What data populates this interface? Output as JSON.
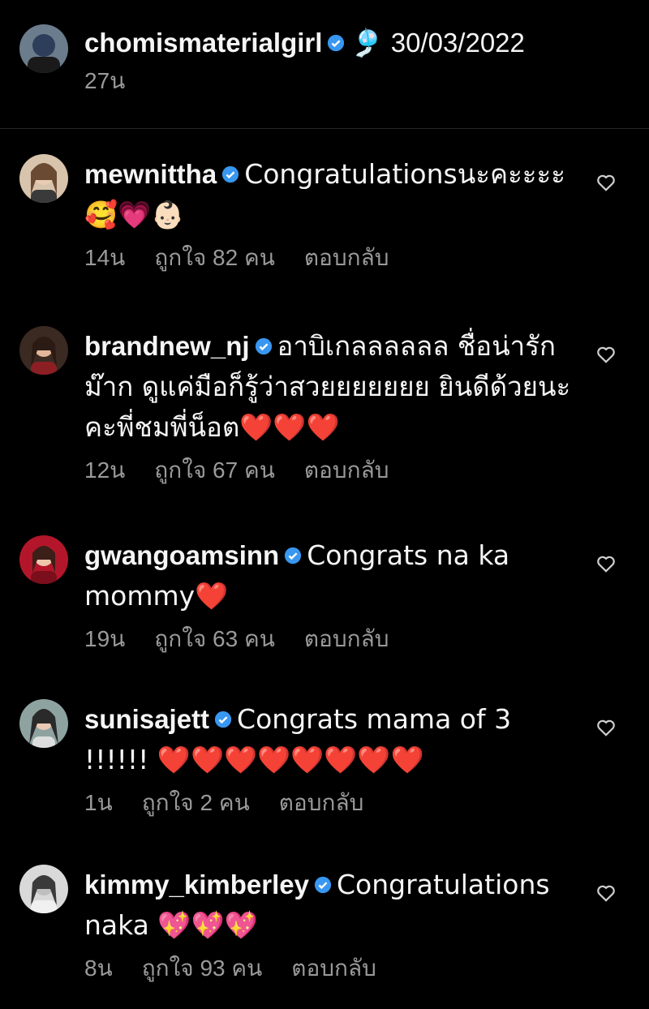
{
  "post": {
    "username": "chomismaterialgirl",
    "caption": "🎐 30/03/2022",
    "time": "27น"
  },
  "comments": [
    {
      "username": "mewnittha",
      "text": "Congratulationsนะคะะะะ🥰💗👶🏻",
      "time": "14น",
      "likes": "ถูกใจ 82 คน",
      "reply": "ตอบกลับ"
    },
    {
      "username": "brandnew_nj",
      "text": "อาบิเกลลลลลล ชื่อน่ารักม๊าก ดูแค่มือก็รู้ว่าสวยยยยยยย ยินดีด้วยนะคะพี่ชมพี่น็อต❤️❤️❤️",
      "time": "12น",
      "likes": "ถูกใจ 67 คน",
      "reply": "ตอบกลับ"
    },
    {
      "username": "gwangoamsinn",
      "text": "Congrats na ka mommy❤️",
      "time": "19น",
      "likes": "ถูกใจ 63 คน",
      "reply": "ตอบกลับ"
    },
    {
      "username": "sunisajett",
      "text": "Congrats mama of 3 !!!!!! ❤️❤️❤️❤️❤️❤️❤️❤️",
      "time": "1น",
      "likes": "ถูกใจ 2 คน",
      "reply": "ตอบกลับ"
    },
    {
      "username": "kimmy_kimberley",
      "text": "Congratulations naka 💖💖💖",
      "time": "8น",
      "likes": "ถูกใจ 93 คน",
      "reply": "ตอบกลับ"
    }
  ],
  "colors": {
    "verified": "#3897f0",
    "meta": "#9a9a9a",
    "background": "#000000"
  },
  "icons": {
    "like": "heart-outline-icon",
    "verified": "verified-badge-icon"
  }
}
